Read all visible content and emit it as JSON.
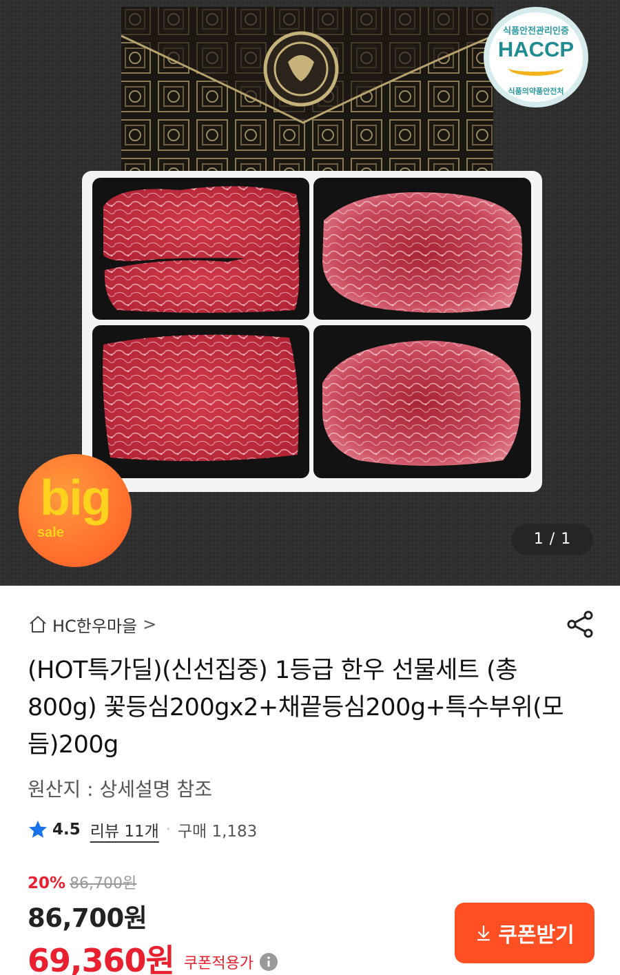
{
  "hero": {
    "haccp_top": "식품안전관리인증",
    "haccp_mark": "HACCP",
    "haccp_bottom": "식품의약품안전처",
    "badge_big": "big",
    "badge_sale": "sale",
    "image_counter": "1 / 1"
  },
  "store": {
    "name": "HC한우마을",
    "chevron": ">"
  },
  "product": {
    "title": "(HOT특가딜)(신선집중) 1등급 한우 선물세트 (총 800g) 꽃등심200gx2+채끝등심200g+특수부위(모듬)200g",
    "origin": "원산지 : 상세설명 참조"
  },
  "rating": {
    "score": "4.5",
    "reviews": "리뷰 11개",
    "separator": "·",
    "purchases": "구매 1,183"
  },
  "price": {
    "discount_rate": "20%",
    "original": "86,700원",
    "sale": "86,700원",
    "coupon_price": "69,360원",
    "coupon_label": "쿠폰적용가"
  },
  "coupon_button": {
    "label": "쿠폰받기"
  },
  "colors": {
    "accent": "#e8202f",
    "button": "#ff4f23",
    "star": "#1a73e8"
  }
}
